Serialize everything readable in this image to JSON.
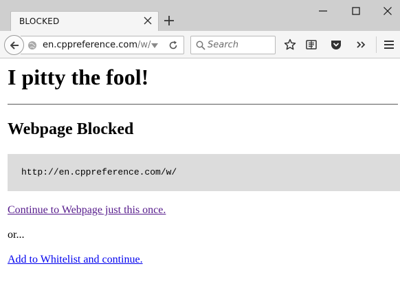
{
  "browser": {
    "tab": {
      "title": "BLOCKED"
    },
    "url": {
      "host": "en.cppreference.com",
      "path": "/w/"
    },
    "search": {
      "placeholder": "Search"
    }
  },
  "page": {
    "title": "I pitty the fool!",
    "heading": "Webpage Blocked",
    "blocked_url": "http://en.cppreference.com/w/",
    "continue_link": "Continue to Webpage just this once.",
    "or_text": "or...",
    "whitelist_link": "Add to Whitelist and continue."
  },
  "colors": {
    "visited_link": "#551a8b",
    "link": "#0000ee",
    "url_box_bg": "#dcdcdc"
  }
}
